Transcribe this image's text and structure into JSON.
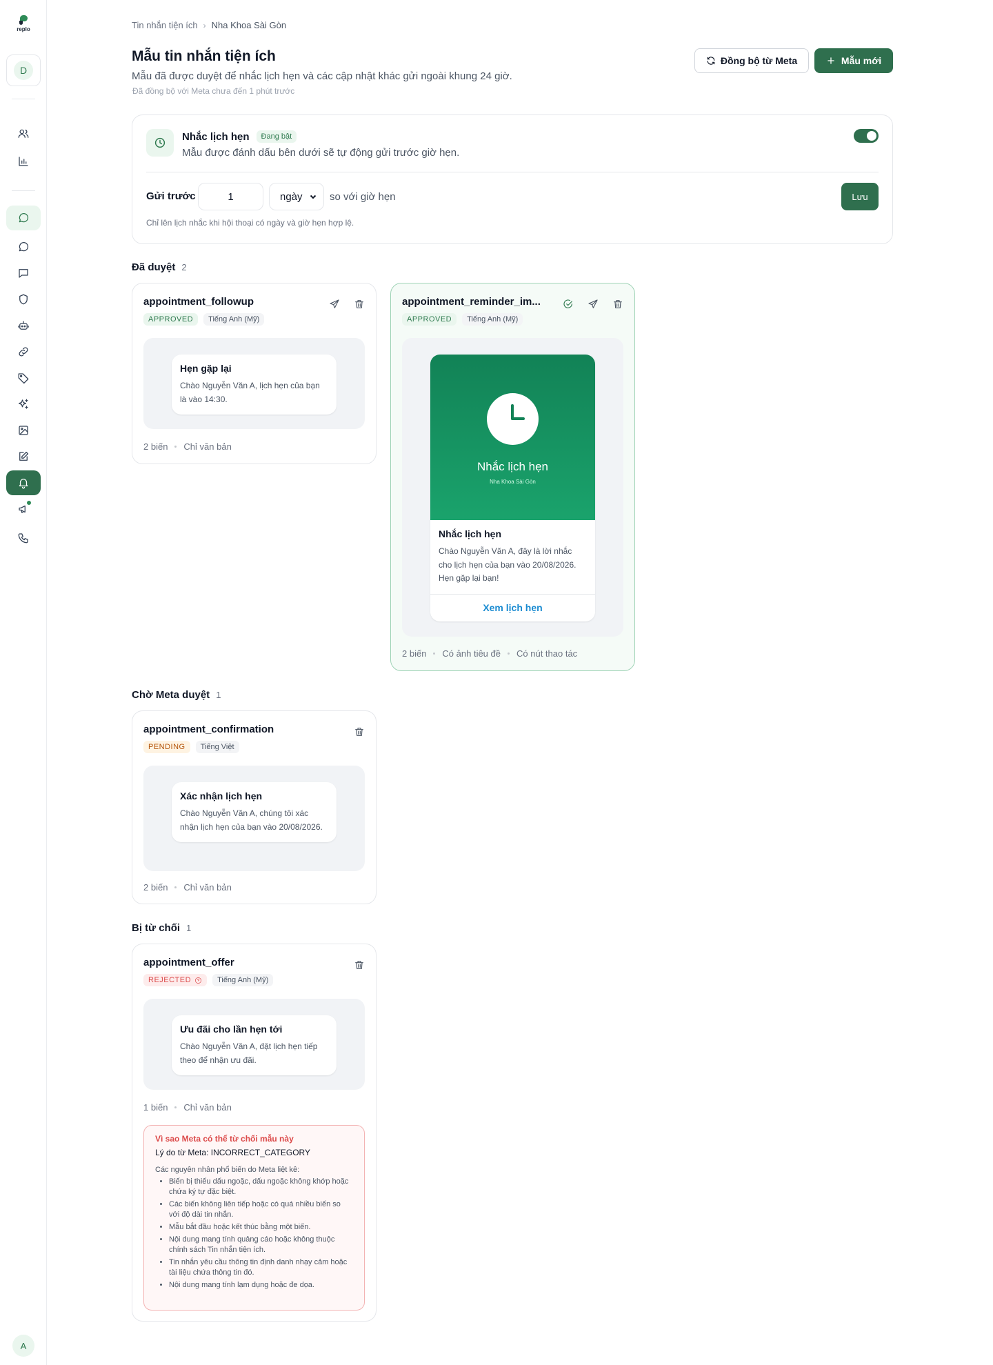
{
  "sidebar": {
    "logo_text": "replo",
    "workspace_initial": "D",
    "user_initial": "A"
  },
  "breadcrumb": {
    "parent": "Tin nhắn tiện ích",
    "current": "Nha Khoa Sài Gòn"
  },
  "header": {
    "title": "Mẫu tin nhắn tiện ích",
    "subtitle": "Mẫu đã được duyệt để nhắc lịch hẹn và các cập nhật khác gửi ngoài khung 24 giờ.",
    "synced": "Đã đồng bộ với Meta chưa đến 1 phút trước",
    "sync_button": "Đồng bộ từ Meta",
    "new_button": "Mẫu mới"
  },
  "reminder": {
    "title": "Nhắc lịch hẹn",
    "status": "Đang bật",
    "desc": "Mẫu được đánh dấu bên dưới sẽ tự động gửi trước giờ hẹn.",
    "enabled": true,
    "send_before_label": "Gửi trước",
    "send_before_value": "1",
    "unit": "ngày",
    "after_text": "so với giờ hẹn",
    "save_button": "Lưu",
    "note": "Chỉ lên lịch nhắc khi hội thoại có ngày và giờ hẹn hợp lệ."
  },
  "sections": {
    "approved": {
      "title": "Đã duyệt",
      "count": "2"
    },
    "pending": {
      "title": "Chờ Meta duyệt",
      "count": "1"
    },
    "rejected": {
      "title": "Bị từ chối",
      "count": "1"
    }
  },
  "templates": {
    "followup": {
      "name": "appointment_followup",
      "status": "APPROVED",
      "language": "Tiếng Anh (Mỹ)",
      "title": "Hẹn gặp lại",
      "body": "Chào Nguyễn Văn A, lịch hẹn của bạn là vào 14:30.",
      "vars": "2 biến",
      "kind": "Chỉ văn bản"
    },
    "reminder": {
      "name": "appointment_reminder_im...",
      "status": "APPROVED",
      "language": "Tiếng Anh (Mỹ)",
      "image_title": "Nhắc lịch hẹn",
      "image_subtitle": "Nha Khoa Sài Gòn",
      "title": "Nhắc lịch hẹn",
      "body": "Chào Nguyễn Văn A, đây là lời nhắc cho lịch hẹn của bạn vào 20/08/2026. Hẹn gặp lại bạn!",
      "button": "Xem lịch hẹn",
      "vars": "2 biến",
      "kind_1": "Có ảnh tiêu đề",
      "kind_2": "Có nút thao tác"
    },
    "confirmation": {
      "name": "appointment_confirmation",
      "status": "PENDING",
      "language": "Tiếng Việt",
      "title": "Xác nhận lịch hẹn",
      "body": "Chào Nguyễn Văn A, chúng tôi xác nhận lịch hẹn của bạn vào 20/08/2026.",
      "vars": "2 biến",
      "kind": "Chỉ văn bản"
    },
    "offer": {
      "name": "appointment_offer",
      "status": "REJECTED",
      "language": "Tiếng Anh (Mỹ)",
      "title": "Ưu đãi cho lần hẹn tới",
      "body": "Chào Nguyễn Văn A, đặt lịch hẹn tiếp theo để nhận ưu đãi.",
      "vars": "1 biến",
      "kind": "Chỉ văn bản",
      "why_title": "Vì sao Meta có thể từ chối mẫu này",
      "reason": "Lý do từ Meta: INCORRECT_CATEGORY",
      "intro": "Các nguyên nhân phổ biến do Meta liệt kê:",
      "causes": [
        "Biến bị thiếu dấu ngoặc, dấu ngoặc không khớp hoặc chứa ký tự đặc biệt.",
        "Các biến không liên tiếp hoặc có quá nhiều biến so với độ dài tin nhắn.",
        "Mẫu bắt đầu hoặc kết thúc bằng một biến.",
        "Nội dung mang tính quảng cáo hoặc không thuộc chính sách Tin nhắn tiện ích.",
        "Tin nhắn yêu cầu thông tin định danh nhạy cảm hoặc tài liệu chứa thông tin đó.",
        "Nội dung mang tính lạm dụng hoặc đe dọa."
      ]
    }
  }
}
